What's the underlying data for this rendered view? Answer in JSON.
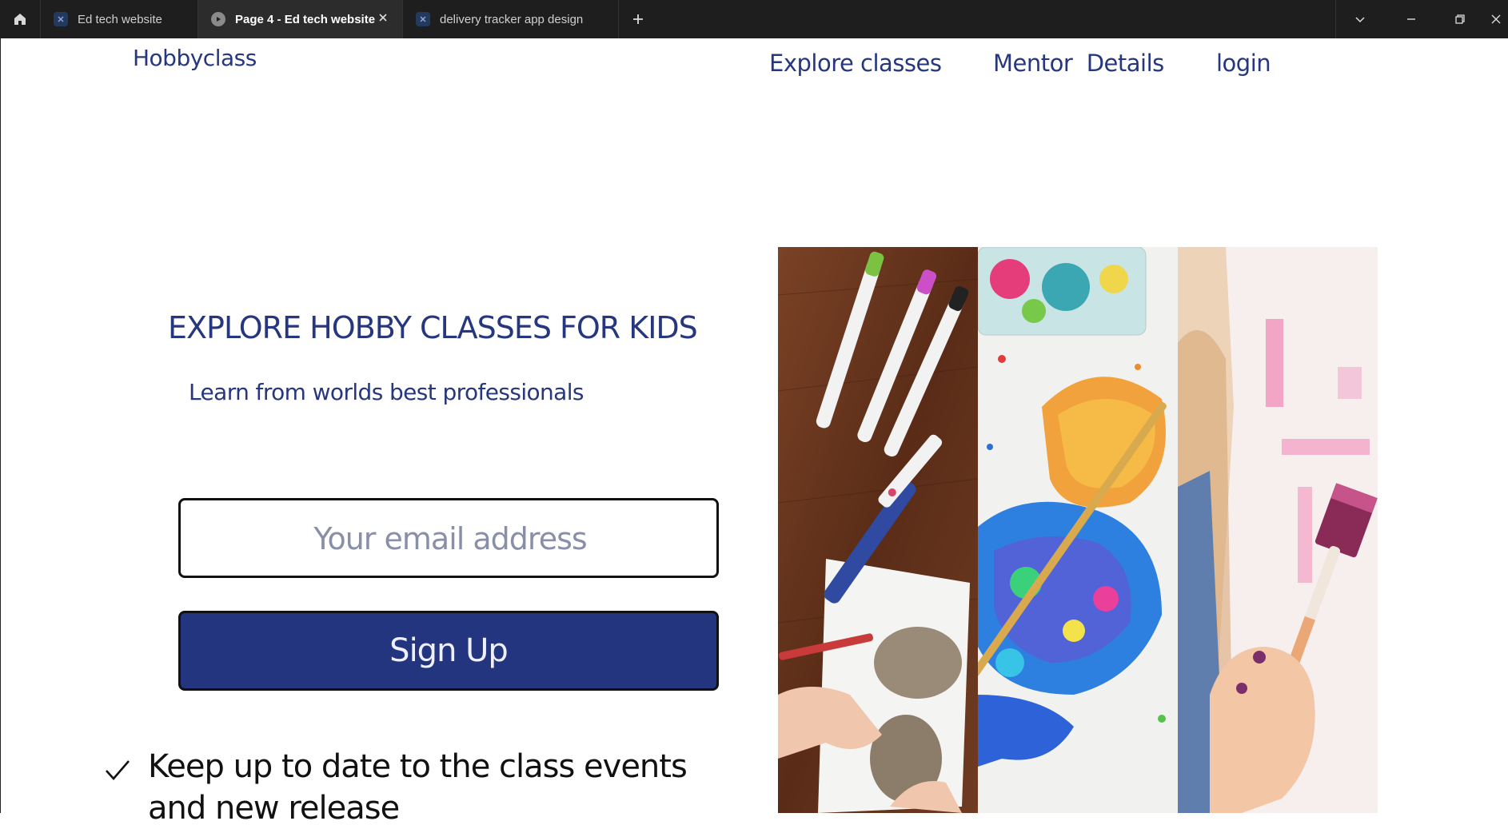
{
  "browser": {
    "tabs": [
      {
        "label": "Ed tech website",
        "active": false
      },
      {
        "label": "Page 4 - Ed tech website",
        "active": true
      },
      {
        "label": "delivery tracker app design",
        "active": false
      }
    ]
  },
  "nav": {
    "brand": "Hobbyclass",
    "links": [
      "Explore classes",
      "Mentor  Details",
      "login"
    ]
  },
  "hero": {
    "headline": "EXPLORE HOBBY CLASSES FOR KIDS",
    "subheadline": "Learn from worlds best professionals",
    "email_placeholder": "Your email address",
    "signup_label": "Sign Up",
    "feature_text": "Keep up to date to the class events and new release"
  },
  "colors": {
    "brand_navy": "#26377f",
    "button_fill": "#24357f"
  },
  "icons": {
    "feature_bullet": "checkmark-icon",
    "home": "home-icon",
    "new_tab": "plus-icon"
  }
}
